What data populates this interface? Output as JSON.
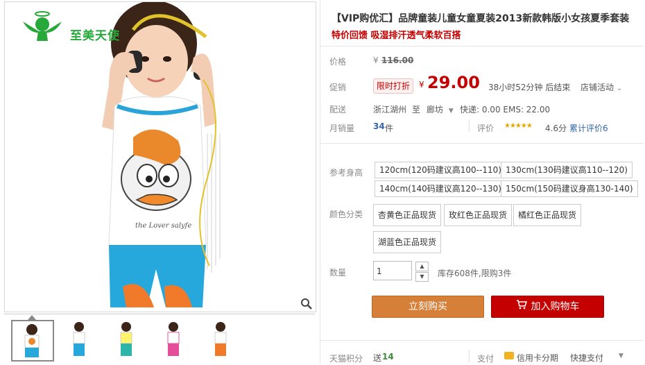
{
  "gallery": {
    "logo_text": "至美天使",
    "thumb_count": 5,
    "active_thumb": 0
  },
  "product": {
    "title": "【VIP购优汇】品牌童装儿童女童夏装2013新款韩版小女孩夏季套装",
    "subtitle": "特价回馈 吸湿排汗透气柔软百搭"
  },
  "price": {
    "label": "价格",
    "currency": "¥",
    "original": "116.00"
  },
  "promo": {
    "label": "促销",
    "badge": "限时打折",
    "currency": "¥",
    "price": "29.00",
    "countdown": "38小时52分钟 后结束",
    "shop_activity": "店铺活动"
  },
  "shipping": {
    "label": "配送",
    "from": "浙江湖州",
    "to_word": "至",
    "to": "廊坊",
    "fees": "快递: 0.00 EMS: 22.00"
  },
  "sales": {
    "label": "月销量",
    "count": "34",
    "unit": "件",
    "rating_label": "评价",
    "stars": "★★★★★",
    "score": "4.6分",
    "total_reviews": "累计评价6"
  },
  "height": {
    "label": "参考身高",
    "options": [
      "120cm(120码建议高100--110)",
      "130cm(130码建议高110--120)",
      "140cm(140码建议高120--130)",
      "150cm(150码建议身高130-140)"
    ]
  },
  "color": {
    "label": "颜色分类",
    "options": [
      "杏黄色正品现货",
      "玫红色正品现货",
      "橘红色正品现货",
      "湖蓝色正品现货"
    ]
  },
  "quantity": {
    "label": "数量",
    "value": "1",
    "stock": "库存608件,限购3件"
  },
  "actions": {
    "buy_now": "立刻购买",
    "add_cart": "加入购物车"
  },
  "footer": {
    "points_label": "天猫积分",
    "points_prefix": "送",
    "points_value": "14",
    "pay_label": "支付",
    "credit": "信用卡分期",
    "quick_pay": "快捷支付"
  },
  "colors": {
    "accent_red": "#c40000",
    "buy_orange": "#d57f39",
    "logo_green": "#27a83a"
  }
}
